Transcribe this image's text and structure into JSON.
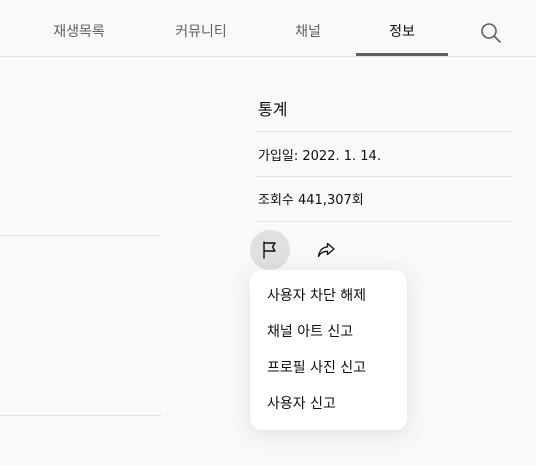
{
  "tabs": [
    {
      "label": "재생목록",
      "selected": false
    },
    {
      "label": "커뮤니티",
      "selected": false
    },
    {
      "label": "채널",
      "selected": false
    },
    {
      "label": "정보",
      "selected": true
    }
  ],
  "search_icon": "search-icon",
  "stats": {
    "title": "통계",
    "joined": "가입일: 2022. 1. 14.",
    "views": "조회수 441,307회"
  },
  "actions": {
    "flag_icon": "flag-icon",
    "share_icon": "share-icon"
  },
  "menu": {
    "items": [
      {
        "label": "사용자 차단 해제"
      },
      {
        "label": "채널 아트 신고"
      },
      {
        "label": "프로필 사진 신고"
      },
      {
        "label": "사용자 신고"
      }
    ]
  },
  "colors": {
    "background": "#f9f9f9",
    "divider": "#e5e5e5",
    "tab_inactive": "#606060",
    "text": "#0f0f0f",
    "menu_bg": "#ffffff",
    "flag_bg": "#e0e0e0"
  }
}
